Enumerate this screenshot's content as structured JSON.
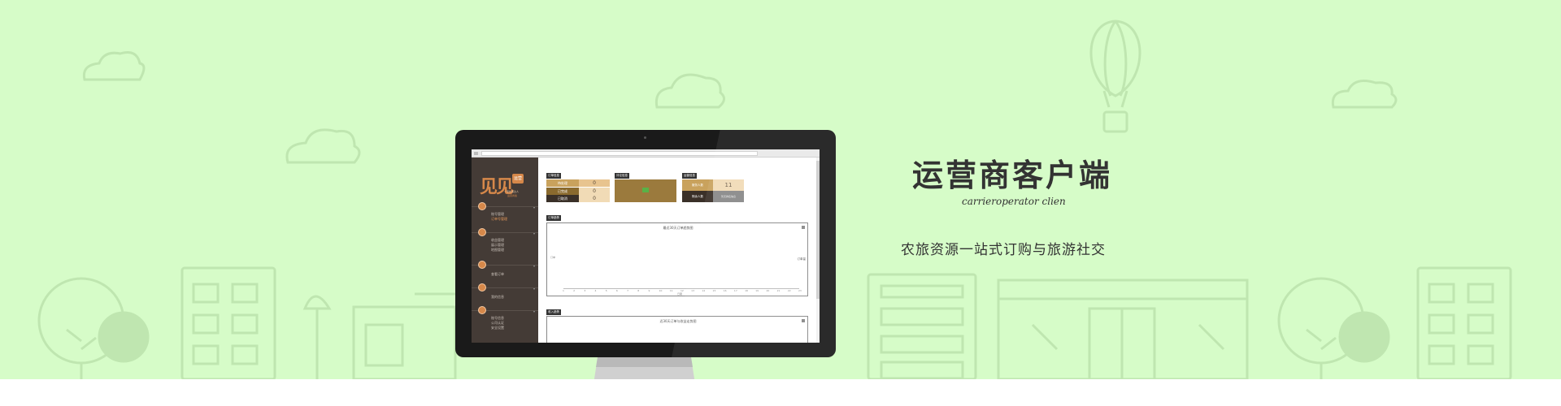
{
  "hero": {
    "title": "运营商客户端",
    "subtitle": "carrieroperator clien",
    "tagline": "农旅资源一站式订购与旅游社交"
  },
  "colors": {
    "background": "#d6fcc8",
    "line_art": "#bfe6b0",
    "accent": "#d6884a",
    "sidebar": "#443b36"
  },
  "app": {
    "logo_text": "见见",
    "logo_badge": "运营",
    "logo_sub": "一家伴游达人",
    "logo_sub2": "运营商版",
    "sidebar": {
      "sections": [
        {
          "icon": "user-icon",
          "items": [
            "账号管理",
            "订单号管理"
          ]
        },
        {
          "icon": "list-icon",
          "items": [
            "收益管理",
            "展示管理",
            "地图管理"
          ]
        },
        {
          "icon": "order-icon",
          "items": [
            "查看订单"
          ]
        },
        {
          "icon": "chat-icon",
          "items": [
            "我的信息"
          ]
        },
        {
          "icon": "settings-icon",
          "items": [
            "账号信息",
            "公司认证",
            "安全设置"
          ]
        }
      ]
    },
    "cards": {
      "card1_title": "订单信息",
      "card1_rows": [
        {
          "label": "待处理",
          "value": "0"
        },
        {
          "label": "已完成",
          "value": "0"
        },
        {
          "label": "已取消",
          "value": "0"
        }
      ],
      "card2_title": "评论信息",
      "card3_title": "运营信息",
      "card3_label": "服务人数",
      "card3_value": "11",
      "card3_label2": "剩余人数",
      "card3_value2": "暂无排名信息"
    },
    "chart_section_label": "订单趋势",
    "chart_title": "最近30天订单趋势图",
    "chart_legend": "订单量",
    "chart_x_unit": "日期",
    "chart_y_unit": "订单",
    "chart2_section_label": "收入趋势",
    "chart2_title": "近30天订单与收益走势图"
  },
  "chart_data": {
    "type": "line",
    "title": "最近30天订单趋势图",
    "x": [
      "1",
      "2",
      "3",
      "4",
      "5",
      "6",
      "7",
      "8",
      "9",
      "10",
      "11",
      "12",
      "13",
      "14",
      "15",
      "16",
      "17",
      "18",
      "19",
      "20",
      "21",
      "22",
      "23"
    ],
    "series": [
      {
        "name": "订单量",
        "values": [
          0,
          0,
          0,
          0,
          0,
          0,
          0,
          0,
          0,
          0,
          0,
          0,
          0,
          0,
          0,
          0,
          0,
          0,
          0,
          0,
          0,
          0,
          0
        ]
      }
    ]
  }
}
